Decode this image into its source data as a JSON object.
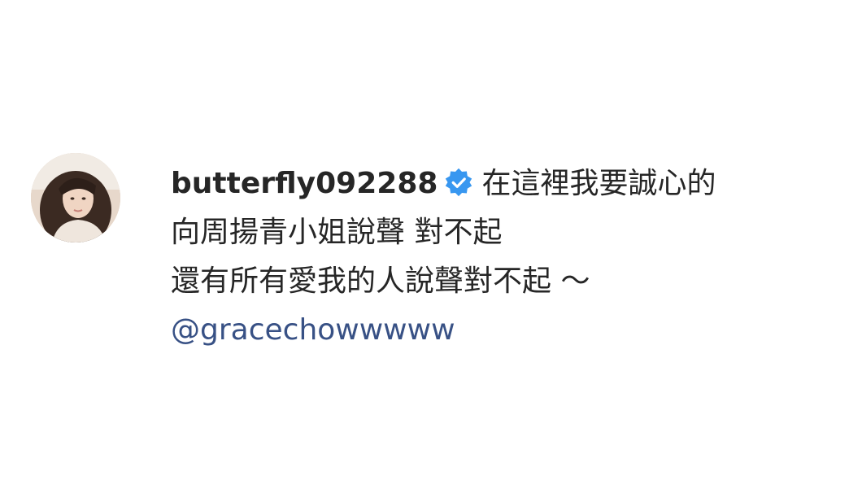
{
  "comment": {
    "username": "butterfly092288",
    "verified_icon": "verified-badge-icon",
    "text_line_1": "在這裡我要誠心的",
    "text_line_2": "向周揚青小姐說聲 對不起",
    "text_line_3": "還有所有愛我的人說聲對不起 ～",
    "mention": "@gracechowwwww"
  },
  "colors": {
    "text": "#262626",
    "verified_blue": "#3897f0",
    "mention": "#385185"
  }
}
